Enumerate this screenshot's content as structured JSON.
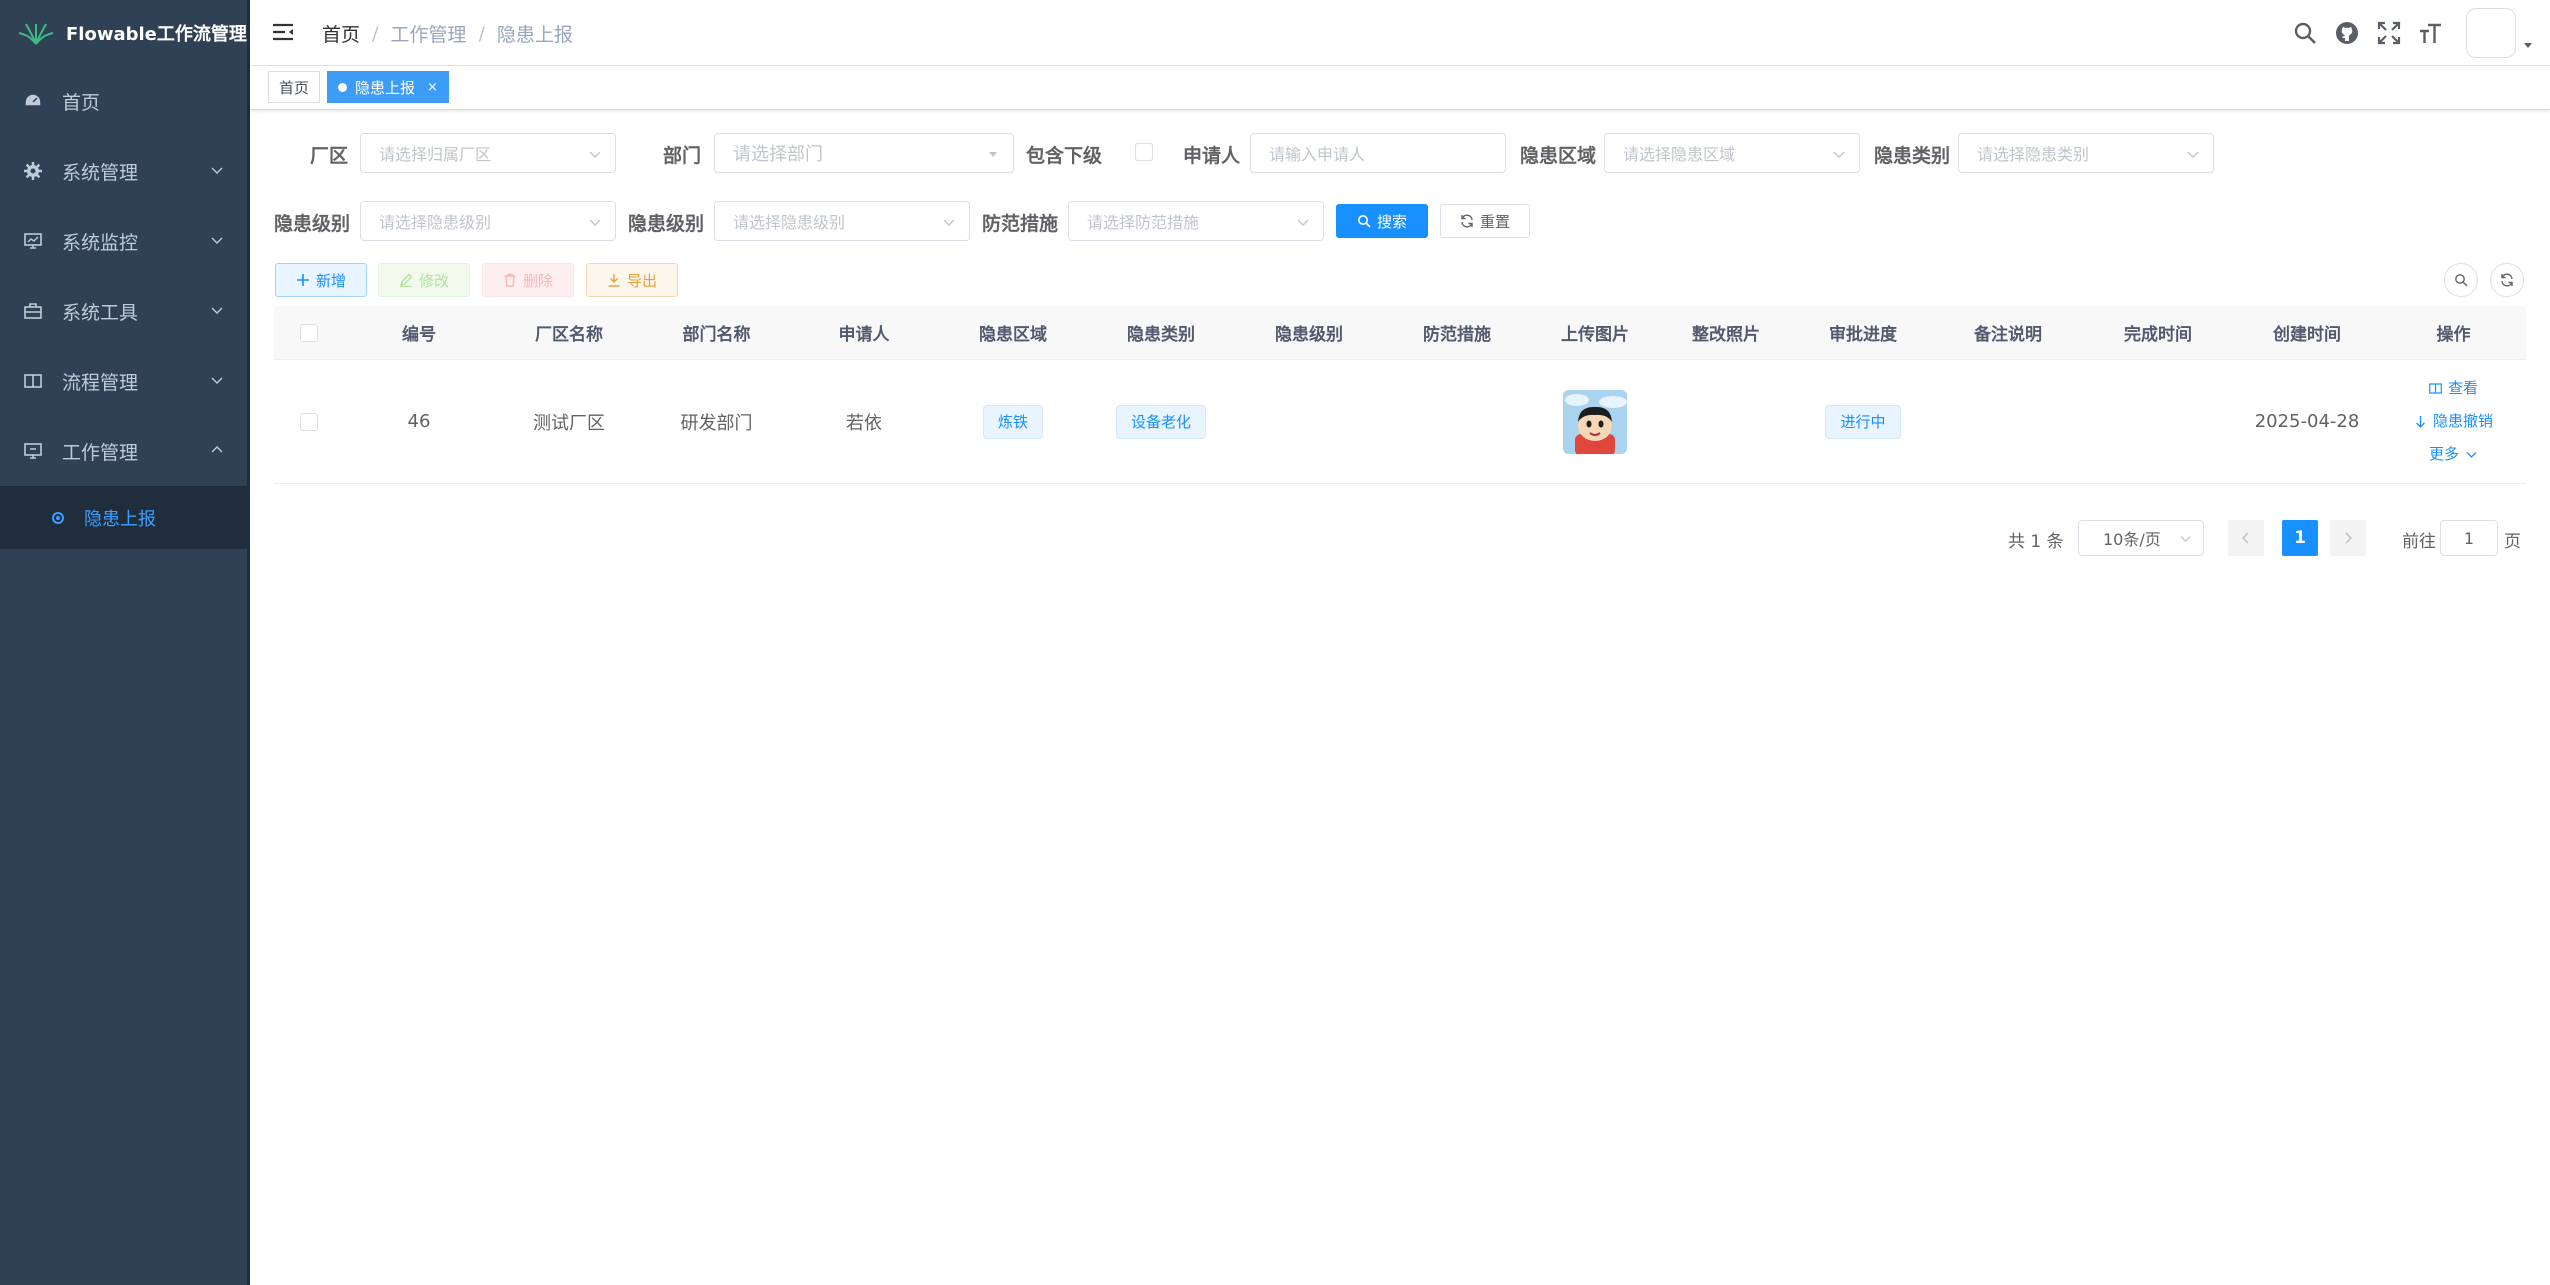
{
  "app": {
    "title": "Flowable工作流管理"
  },
  "sidebar": {
    "items": [
      {
        "label": "首页",
        "icon": "dashboard-icon"
      },
      {
        "label": "系统管理",
        "icon": "gear-icon"
      },
      {
        "label": "系统监控",
        "icon": "monitor-icon"
      },
      {
        "label": "系统工具",
        "icon": "toolbox-icon"
      },
      {
        "label": "流程管理",
        "icon": "book-icon"
      },
      {
        "label": "工作管理",
        "icon": "work-icon"
      }
    ],
    "sub_item": "隐患上报"
  },
  "breadcrumb": [
    "首页",
    "工作管理",
    "隐患上报"
  ],
  "tags": [
    {
      "label": "首页"
    },
    {
      "label": "隐患上报",
      "close": "×"
    }
  ],
  "search": {
    "factory_label": "厂区",
    "factory_placeholder": "请选择归属厂区",
    "dept_label": "部门",
    "dept_placeholder": "请选择部门",
    "include_sub_label": "包含下级",
    "applicant_label": "申请人",
    "applicant_placeholder": "请输入申请人",
    "area_label": "隐患区域",
    "area_placeholder": "请选择隐患区域",
    "type_label": "隐患类别",
    "type_placeholder": "请选择隐患类别",
    "level1_label": "隐患级别",
    "level1_placeholder": "请选择隐患级别",
    "level2_label": "隐患级别",
    "level2_placeholder": "请选择隐患级别",
    "measure_label": "防范措施",
    "measure_placeholder": "请选择防范措施",
    "search_btn": "搜索",
    "reset_btn": "重置"
  },
  "toolbar": {
    "add": "新增",
    "edit": "修改",
    "delete": "删除",
    "export": "导出"
  },
  "table": {
    "headers": [
      "编号",
      "厂区名称",
      "部门名称",
      "申请人",
      "隐患区域",
      "隐患类别",
      "隐患级别",
      "防范措施",
      "上传图片",
      "整改照片",
      "审批进度",
      "备注说明",
      "完成时间",
      "创建时间",
      "操作"
    ],
    "rows": [
      {
        "id": "46",
        "factory": "测试厂区",
        "dept": "研发部门",
        "applicant": "若依",
        "area": "炼铁",
        "type": "设备老化",
        "level": "",
        "measure": "",
        "image": "cartoon-avatar",
        "rectify_photo": "",
        "progress": "进行中",
        "remark": "",
        "finish_time": "",
        "create_time": "2025-04-28",
        "ops": [
          "查看",
          "隐患撤销",
          "更多"
        ]
      }
    ]
  },
  "pagination": {
    "total": "共 1 条",
    "page_size": "10条/页",
    "current": "1",
    "goto_prefix": "前往",
    "goto_value": "1",
    "goto_suffix": "页"
  },
  "colors": {
    "sidebar_bg": "#304156",
    "primary": "#1890ff",
    "active_menu": "#409eff"
  }
}
